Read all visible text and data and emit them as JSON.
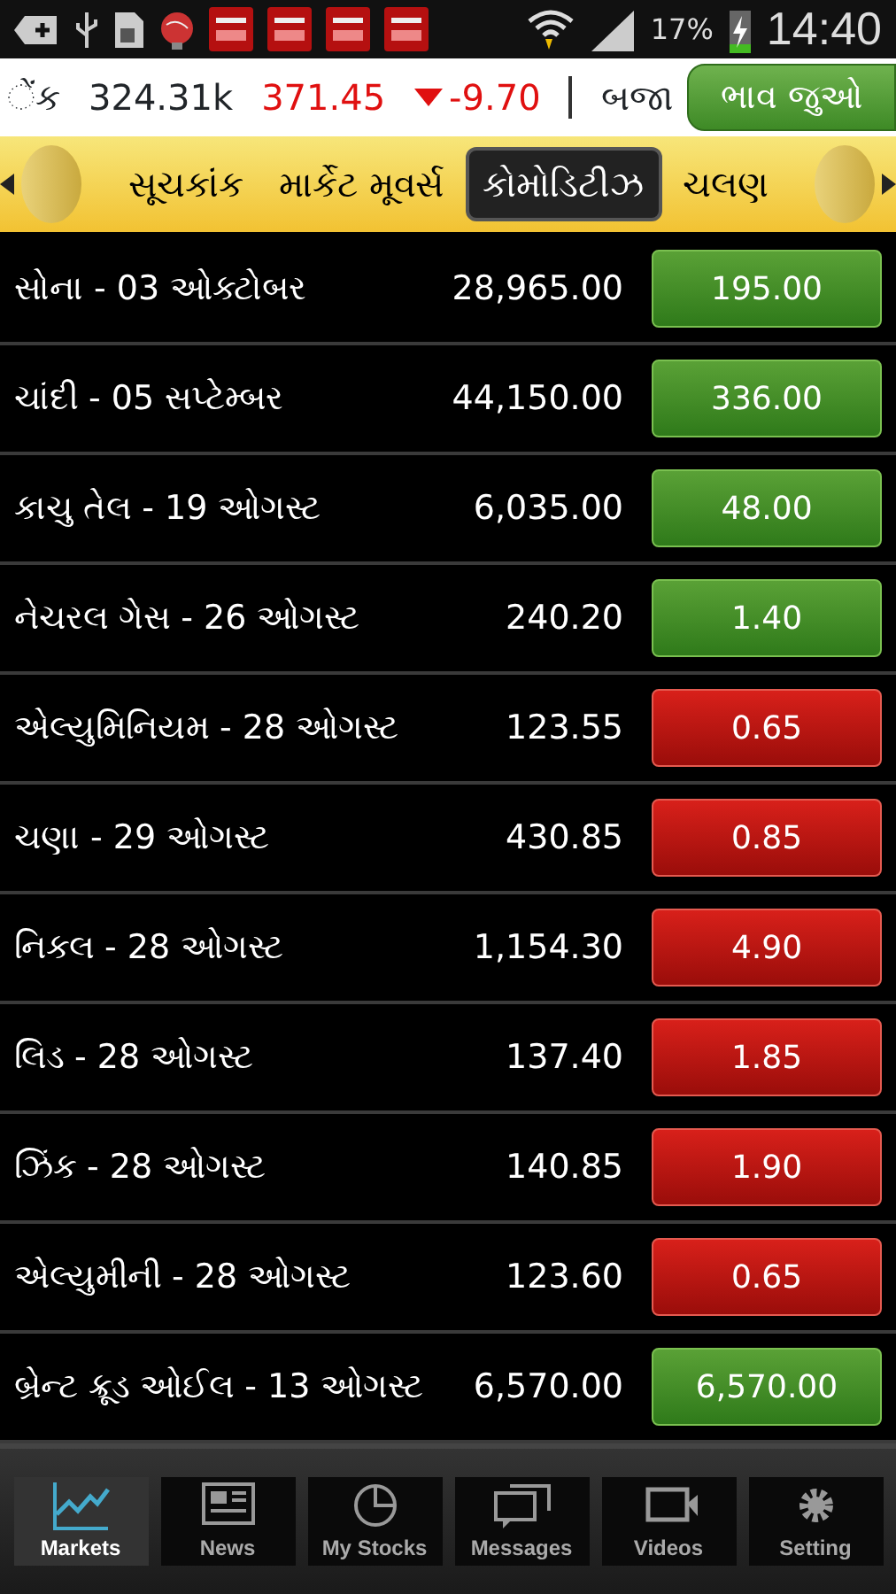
{
  "status_bar": {
    "battery": "17%",
    "time": "14:40"
  },
  "ticker": {
    "lead": "ેંક",
    "volume": "324.31k",
    "price": "371.45",
    "change": "-9.70",
    "kind": "down",
    "next": "બજા",
    "button": "ભાવ જુઓ"
  },
  "tabs": [
    {
      "label": "સૂચકાંક",
      "selected": false
    },
    {
      "label": "માર્કેટ મૂવર્સ",
      "selected": false
    },
    {
      "label": "કોમોડિટીઝ",
      "selected": true
    },
    {
      "label": "ચલણ",
      "selected": false
    }
  ],
  "rows": [
    {
      "name": "સોના - 03 ઓક્ટોબર",
      "price": "28,965.00",
      "change": "195.00",
      "kind": "up"
    },
    {
      "name": "ચાંદી - 05 સપ્ટેમ્બર",
      "price": "44,150.00",
      "change": "336.00",
      "kind": "up"
    },
    {
      "name": "કાચુ તેલ - 19 ઓગસ્ટ",
      "price": "6,035.00",
      "change": "48.00",
      "kind": "up"
    },
    {
      "name": "નેચરલ ગેસ - 26 ઓગસ્ટ",
      "price": "240.20",
      "change": "1.40",
      "kind": "up"
    },
    {
      "name": "એલ્યુમિનિયમ - 28 ઓગસ્ટ",
      "price": "123.55",
      "change": "0.65",
      "kind": "down"
    },
    {
      "name": "ચણા - 29 ઓગસ્ટ",
      "price": "430.85",
      "change": "0.85",
      "kind": "down"
    },
    {
      "name": "નિકલ - 28 ઓગસ્ટ",
      "price": "1,154.30",
      "change": "4.90",
      "kind": "down"
    },
    {
      "name": "લિડ - 28 ઓગસ્ટ",
      "price": "137.40",
      "change": "1.85",
      "kind": "down"
    },
    {
      "name": "ઝિંક - 28 ઓગસ્ટ",
      "price": "140.85",
      "change": "1.90",
      "kind": "down"
    },
    {
      "name": "એલ્યુમીની - 28 ઓગસ્ટ",
      "price": "123.60",
      "change": "0.65",
      "kind": "down"
    },
    {
      "name": "બ્રેન્ટ ક્રૂડ ઓઈલ - 13 ઓગસ્ટ",
      "price": "6,570.00",
      "change": "6,570.00",
      "kind": "up"
    }
  ],
  "nav": [
    {
      "label": "Markets",
      "kind": "chart",
      "selected": true
    },
    {
      "label": "News",
      "kind": "news",
      "selected": false
    },
    {
      "label": "My Stocks",
      "kind": "pie",
      "selected": false
    },
    {
      "label": "Messages",
      "kind": "messages",
      "selected": false
    },
    {
      "label": "Videos",
      "kind": "video",
      "selected": false
    },
    {
      "label": "Setting",
      "kind": "gear",
      "selected": false
    }
  ]
}
